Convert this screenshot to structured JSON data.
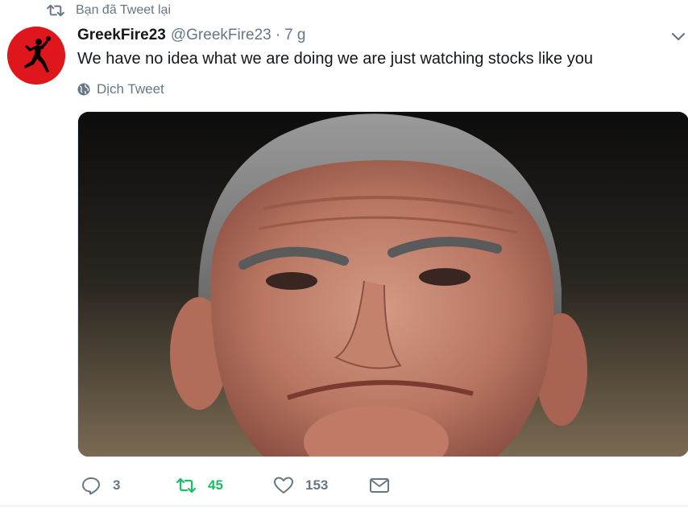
{
  "context": {
    "retweet_label": "Bạn đã Tweet lại",
    "icon": "retweet-icon"
  },
  "tweet": {
    "display_name": "GreekFire23",
    "handle": "@GreekFire23",
    "separator": "·",
    "time": "7 g",
    "text": "We have no idea what we are doing we are just watching stocks like you",
    "translate_label": "Dịch Tweet",
    "avatar_icon": "jumpman-logo",
    "avatar_color": "#e0161d"
  },
  "actions": {
    "reply_count": "3",
    "retweet_count": "45",
    "like_count": "153",
    "retweet_active_color": "#17bf63"
  },
  "colors": {
    "text_primary": "#14171a",
    "text_secondary": "#657786",
    "border": "#e1e8ed"
  }
}
